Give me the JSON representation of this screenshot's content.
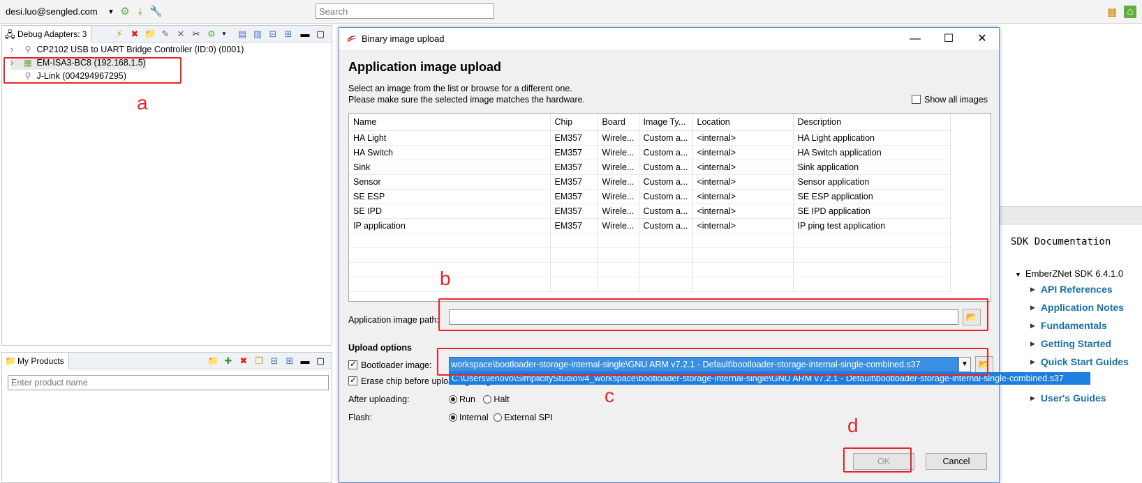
{
  "topbar": {
    "user_email": "desi.luo@sengled.com",
    "search_placeholder": "Search"
  },
  "debug_adapters": {
    "tab_label": "Debug Adapters: 3",
    "items": [
      {
        "label": "CP2102 USB to UART Bridge Controller (ID:0) (0001)",
        "icon": "usb-icon"
      },
      {
        "label": "EM-ISA3-BC8 (192.168.1.5)",
        "icon": "network-adapter-icon"
      },
      {
        "label": "J-Link (004294967295)",
        "icon": "usb-icon"
      }
    ]
  },
  "my_products": {
    "tab_label": "My Products",
    "input_placeholder": "Enter product name"
  },
  "dialog": {
    "window_title": "Binary image upload",
    "heading": "Application image upload",
    "line1": "Select an image from the list or browse for a different one.",
    "line2": "Please make sure the selected image matches the hardware.",
    "show_all_label": "Show all images",
    "table": {
      "columns": [
        "Name",
        "Chip",
        "Board",
        "Image Ty...",
        "Location",
        "Description"
      ],
      "rows": [
        [
          "HA Light",
          "EM357",
          "Wirele...",
          "Custom a...",
          "<internal>",
          "HA Light application"
        ],
        [
          "HA Switch",
          "EM357",
          "Wirele...",
          "Custom a...",
          "<internal>",
          "HA Switch application"
        ],
        [
          "Sink",
          "EM357",
          "Wirele...",
          "Custom a...",
          "<internal>",
          "Sink application"
        ],
        [
          "Sensor",
          "EM357",
          "Wirele...",
          "Custom a...",
          "<internal>",
          "Sensor application"
        ],
        [
          "SE ESP",
          "EM357",
          "Wirele...",
          "Custom a...",
          "<internal>",
          "SE ESP application"
        ],
        [
          "SE IPD",
          "EM357",
          "Wirele...",
          "Custom a...",
          "<internal>",
          "SE IPD application"
        ],
        [
          "IP application",
          "EM357",
          "Wirele...",
          "Custom a...",
          "<internal>",
          "IP ping test application"
        ]
      ]
    },
    "app_image_path_label": "Application image path:",
    "app_image_path_value": "",
    "upload_options_label": "Upload options",
    "bootloader_label": "Bootloader image:",
    "bootloader_value": "workspace\\bootloader-storage-internal-single\\GNU ARM v7.2.1 - Default\\bootloader-storage-internal-single-combined.s37",
    "bootloader_option_full": "C:\\Users\\lenovo\\SimplicityStudio\\v4_workspace\\bootloader-storage-internal-single\\GNU ARM v7.2.1 - Default\\bootloader-storage-internal-single-combined.s37",
    "erase_label": "Erase chip before uploading image",
    "after_uploading_label": "After uploading:",
    "run_label": "Run",
    "halt_label": "Halt",
    "flash_label": "Flash:",
    "internal_label": "Internal",
    "external_spi_label": "External SPI",
    "ok_label": "OK",
    "cancel_label": "Cancel"
  },
  "sdk_docs": {
    "title": "SDK Documentation",
    "root": "EmberZNet SDK 6.4.1.0",
    "items": [
      "API References",
      "Application Notes",
      "Fundamentals",
      "Getting Started",
      "Quick Start Guides",
      "User's Guides"
    ]
  },
  "annotations": {
    "a": "a",
    "b": "b",
    "c": "c",
    "d": "d",
    "color": "#e8232a"
  }
}
